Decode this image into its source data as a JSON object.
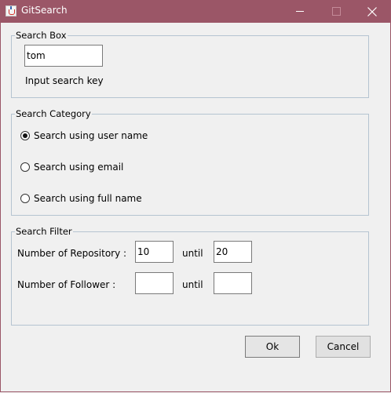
{
  "window": {
    "title": "GitSearch",
    "title_bar_color": "#9b5667"
  },
  "search_box": {
    "legend": "Search Box",
    "input_value": "tom",
    "hint": "Input search key"
  },
  "search_category": {
    "legend": "Search Category",
    "options": [
      {
        "label": "Search using user name",
        "selected": true
      },
      {
        "label": "Search using email",
        "selected": false
      },
      {
        "label": "Search using full name",
        "selected": false
      }
    ]
  },
  "search_filter": {
    "legend": "Search Filter",
    "repository": {
      "label": "Number of Repository :",
      "from": "10",
      "until_label": "until",
      "to": "20"
    },
    "follower": {
      "label": "Number of Follower :",
      "from": "",
      "until_label": "until",
      "to": ""
    }
  },
  "buttons": {
    "ok": "Ok",
    "cancel": "Cancel"
  }
}
